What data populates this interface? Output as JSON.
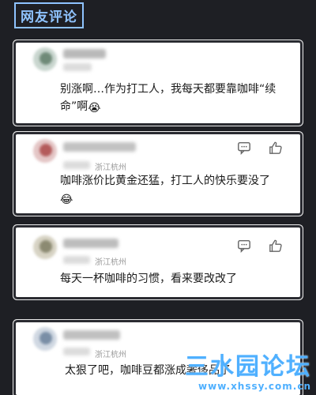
{
  "header": {
    "title": "网友评论"
  },
  "comments": [
    {
      "text": "别涨啊…作为打工人，我每天都要靠咖啡“续命”啊",
      "emoji": "😭",
      "location": "",
      "has_actions": false
    },
    {
      "text": "咖啡涨价比黄金还猛，打工人的快乐要没了",
      "emoji": "😂",
      "location": "浙江杭州",
      "has_actions": true
    },
    {
      "text": "每天一杯咖啡的习惯，看来要改改了",
      "emoji": "",
      "location": "浙江杭州",
      "has_actions": true
    },
    {
      "text": "太狠了吧，咖啡豆都涨成奢侈品了",
      "emoji": "",
      "location": "浙江杭州",
      "has_actions": true
    }
  ],
  "watermark": {
    "title": "三水园论坛",
    "url": "www.xhssy.com.cn"
  },
  "colors": {
    "accent": "#8fc3ff",
    "background": "#1e1f24",
    "watermark": "#4fb0ff"
  },
  "icons": [
    "comment-icon",
    "thumbs-up-icon"
  ]
}
